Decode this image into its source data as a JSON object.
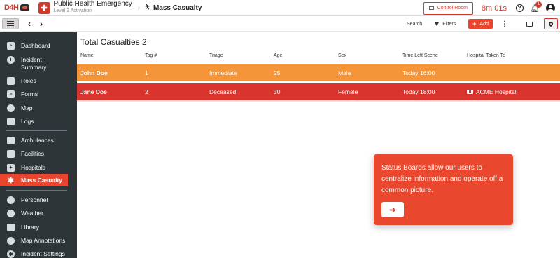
{
  "header": {
    "logo_text": "D4H",
    "incident_title": "Public Health Emergency",
    "incident_subtitle": "Level 3 Activation",
    "breadcrumb_title": "Mass Casualty",
    "control_room_label": "Control Room",
    "timer": "8m 01s",
    "notification_count": "1"
  },
  "toolbar": {
    "search_label": "Search",
    "filters_label": "Filters",
    "add_label": "Add",
    "kebab": "⋮"
  },
  "sidebar": {
    "items": [
      {
        "label": "Dashboard",
        "icon": "dashboard-icon"
      },
      {
        "label": "Incident Summary",
        "icon": "info-icon"
      },
      {
        "label": "Roles",
        "icon": "roles-icon"
      },
      {
        "label": "Forms",
        "icon": "forms-icon"
      },
      {
        "label": "Map",
        "icon": "globe-icon"
      },
      {
        "label": "Logs",
        "icon": "logs-icon"
      },
      {
        "label": "Ambulances",
        "icon": "ambulance-icon"
      },
      {
        "label": "Facilities",
        "icon": "building-icon"
      },
      {
        "label": "Hospitals",
        "icon": "hospital-icon"
      },
      {
        "label": "Mass Casualty",
        "icon": "casualty-icon",
        "active": true
      },
      {
        "label": "Personnel",
        "icon": "person-icon"
      },
      {
        "label": "Weather",
        "icon": "weather-icon"
      },
      {
        "label": "Library",
        "icon": "library-icon"
      },
      {
        "label": "Map Annotations",
        "icon": "pin-icon"
      },
      {
        "label": "Incident Settings",
        "icon": "gear-icon"
      }
    ]
  },
  "main": {
    "title": "Total Casualties 2",
    "columns": [
      "Name",
      "Tag #",
      "Triage",
      "Age",
      "Sex",
      "Time Left Scene",
      "Hospital Taken To"
    ],
    "rows": [
      {
        "name": "John Doe",
        "tag": "1",
        "triage": "Immediate",
        "age": "25",
        "sex": "Male",
        "time_left": "Today 16:00",
        "hospital": "",
        "color": "#f5953a"
      },
      {
        "name": "Jane Doe",
        "tag": "2",
        "triage": "Deceased",
        "age": "30",
        "sex": "Female",
        "time_left": "Today 18:00",
        "hospital": "ACME Hospital",
        "color": "#d9332e"
      }
    ]
  },
  "tooltip": {
    "text": "Status Boards allow our users to centralize information and operate off a common picture.",
    "button_icon": "arrow-right-icon",
    "button_glyph": "➔"
  },
  "colors": {
    "accent": "#e9452f",
    "sidebar_bg": "#2d3539",
    "immediate": "#f5953a",
    "deceased": "#d9332e"
  }
}
